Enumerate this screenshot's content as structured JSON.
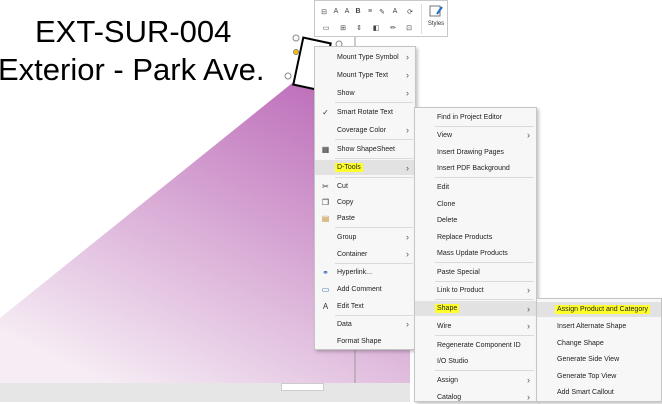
{
  "drawing": {
    "title_line1": "EXT-SUR-004",
    "title_line2": "Exterior - Park Ave.",
    "fill_color_top": "#c074bd",
    "fill_color_bottom": "#f4e8f3"
  },
  "toolbar": {
    "styles_label": "Styles"
  },
  "context_menu": {
    "items": [
      {
        "label": "Mount Type Symbol",
        "icon": "",
        "submenu": true
      },
      {
        "label": "Mount Type Text",
        "icon": "",
        "submenu": true
      },
      {
        "label": "Show",
        "icon": "",
        "submenu": true
      },
      {
        "label": "Smart Rotate Text",
        "icon": "checkmark-icon",
        "submenu": false
      },
      {
        "label": "Coverage Color",
        "icon": "",
        "submenu": true
      },
      {
        "label": "Show ShapeSheet",
        "icon": "shapesheet-icon",
        "submenu": false
      },
      {
        "label": "D-Tools",
        "icon": "",
        "submenu": true
      },
      {
        "label": "Cut",
        "icon": "scissors-icon",
        "submenu": false
      },
      {
        "label": "Copy",
        "icon": "copy-icon",
        "submenu": false
      },
      {
        "label": "Paste",
        "icon": "paste-icon",
        "submenu": false
      },
      {
        "label": "Group",
        "icon": "",
        "submenu": true
      },
      {
        "label": "Container",
        "icon": "",
        "submenu": true
      },
      {
        "label": "Hyperlink...",
        "icon": "hyperlink-icon",
        "submenu": false
      },
      {
        "label": "Add Comment",
        "icon": "comment-icon",
        "submenu": false
      },
      {
        "label": "Edit Text",
        "icon": "edit-text-icon",
        "submenu": false
      },
      {
        "label": "Data",
        "icon": "",
        "submenu": true
      },
      {
        "label": "Format Shape",
        "icon": "",
        "submenu": false
      }
    ]
  },
  "dtools_menu": {
    "items": [
      {
        "label": "Find in Project Editor",
        "submenu": false
      },
      {
        "label": "View",
        "submenu": true
      },
      {
        "label": "Insert Drawing Pages",
        "submenu": false
      },
      {
        "label": "Insert PDF Background",
        "submenu": false
      },
      {
        "label": "Edit",
        "submenu": false
      },
      {
        "label": "Clone",
        "submenu": false
      },
      {
        "label": "Delete",
        "submenu": false
      },
      {
        "label": "Replace Products",
        "submenu": false
      },
      {
        "label": "Mass Update Products",
        "submenu": false
      },
      {
        "label": "Paste Special",
        "submenu": false
      },
      {
        "label": "Link to Product",
        "submenu": true
      },
      {
        "label": "Shape",
        "submenu": true
      },
      {
        "label": "Wire",
        "submenu": true
      },
      {
        "label": "Regenerate Component ID",
        "submenu": false
      },
      {
        "label": "I/O Studio",
        "submenu": false
      },
      {
        "label": "Assign",
        "submenu": true
      },
      {
        "label": "Catalog",
        "submenu": true
      }
    ]
  },
  "shape_menu": {
    "items": [
      {
        "label": "Assign Product and Category"
      },
      {
        "label": "Insert Alternate Shape"
      },
      {
        "label": "Change Shape"
      },
      {
        "label": "Generate Side View"
      },
      {
        "label": "Generate Top View"
      },
      {
        "label": "Add Smart Callout"
      }
    ]
  }
}
